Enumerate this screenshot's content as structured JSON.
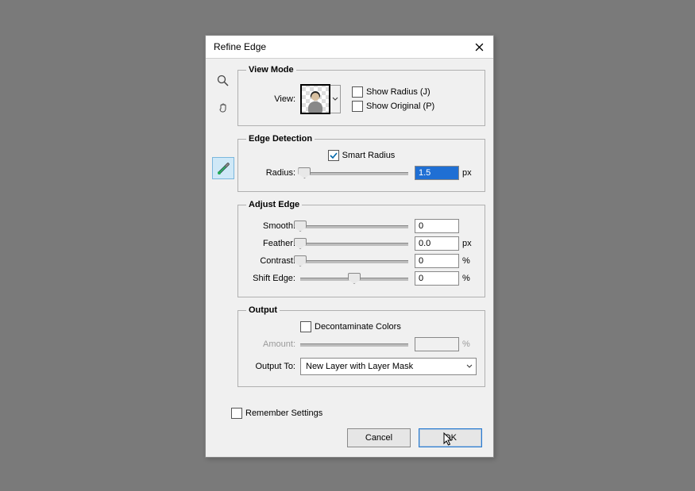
{
  "title": "Refine Edge",
  "tools": {
    "zoom": "zoom-tool",
    "hand": "hand-tool",
    "brush": "refine-radius-tool"
  },
  "viewMode": {
    "legend": "View Mode",
    "viewLabel": "View:",
    "showRadius": {
      "label": "Show Radius (J)",
      "checked": false
    },
    "showOriginal": {
      "label": "Show Original (P)",
      "checked": false
    }
  },
  "edgeDetection": {
    "legend": "Edge Detection",
    "smartRadius": {
      "label": "Smart Radius",
      "checked": true
    },
    "radius": {
      "label": "Radius:",
      "value": "1.5",
      "unit": "px",
      "pos": 4
    }
  },
  "adjustEdge": {
    "legend": "Adjust Edge",
    "smooth": {
      "label": "Smooth:",
      "value": "0",
      "unit": "",
      "pos": 0
    },
    "feather": {
      "label": "Feather:",
      "value": "0.0",
      "unit": "px",
      "pos": 0
    },
    "contrast": {
      "label": "Contrast:",
      "value": "0",
      "unit": "%",
      "pos": 0
    },
    "shiftEdge": {
      "label": "Shift Edge:",
      "value": "0",
      "unit": "%",
      "pos": 50
    }
  },
  "output": {
    "legend": "Output",
    "decontaminate": {
      "label": "Decontaminate Colors",
      "checked": false
    },
    "amount": {
      "label": "Amount:",
      "value": "",
      "unit": "%",
      "pos": 0,
      "disabled": true
    },
    "outputTo": {
      "label": "Output To:",
      "value": "New Layer with Layer Mask"
    }
  },
  "remember": {
    "label": "Remember Settings",
    "checked": false
  },
  "buttons": {
    "cancel": "Cancel",
    "ok": "OK"
  }
}
